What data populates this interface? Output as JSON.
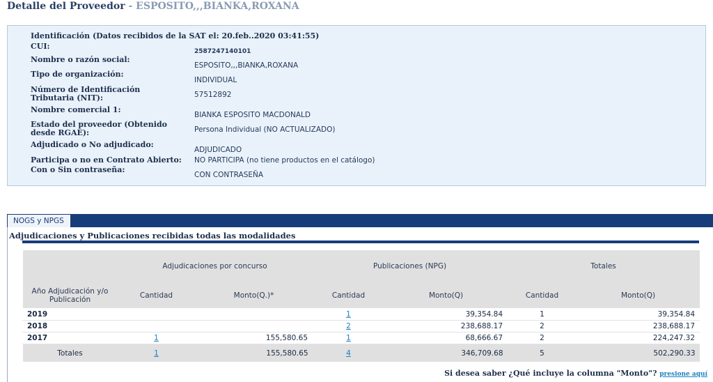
{
  "header": {
    "title": "Detalle del Proveedor",
    "separator": " - ",
    "provider_name": "ESPOSITO,,,BIANKA,ROXANA"
  },
  "info": {
    "identification": "Identificación (Datos recibidos de la SAT el: 20.feb..2020 03:41:55)",
    "fields": [
      {
        "label": "CUI:",
        "value": "2587247140101"
      },
      {
        "label": "Nombre o razón social:",
        "value": "ESPOSITO,,,BIANKA,ROXANA"
      },
      {
        "label": "Tipo de organización:",
        "value": "INDIVIDUAL"
      },
      {
        "label": "Número de Identificación Tributaria (NIT):",
        "value": "57512892"
      },
      {
        "label": "Nombre comercial 1:",
        "value": "BIANKA ESPOSITO MACDONALD"
      },
      {
        "label": "Estado del proveedor (Obtenido desde RGAE):",
        "value": "Persona Individual (NO ACTUALIZADO)"
      },
      {
        "label": "Adjudicado o No adjudicado:",
        "value": "ADJUDICADO"
      },
      {
        "label": "Participa o no en Contrato Abierto:",
        "value": "NO PARTICIPA (no tiene productos en el catálogo)"
      },
      {
        "label": "Con o Sin contraseña:",
        "value": "CON CONTRASEÑA"
      }
    ]
  },
  "tabs": [
    {
      "label": "NOGS y NPGS",
      "active": true
    }
  ],
  "section": {
    "title": "Adjudicaciones y Publicaciones recibidas todas las modalidades"
  },
  "table": {
    "group_headers": [
      "Adjudicaciones por concurso",
      "Publicaciones (NPG)",
      "Totales"
    ],
    "columns": [
      "Año Adjudicación y/o Publicación",
      "Cantidad",
      "Monto(Q.)*",
      "Cantidad",
      "Monto(Q)",
      "Cantidad",
      "Monto(Q)"
    ],
    "rows": [
      {
        "year": "2019",
        "adj_qty": "",
        "adj_amount": "",
        "pub_qty": "1",
        "pub_amount": "39,354.84",
        "tot_qty": "1",
        "tot_amount": "39,354.84"
      },
      {
        "year": "2018",
        "adj_qty": "",
        "adj_amount": "",
        "pub_qty": "2",
        "pub_amount": "238,688.17",
        "tot_qty": "2",
        "tot_amount": "238,688.17"
      },
      {
        "year": "2017",
        "adj_qty": "1",
        "adj_amount": "155,580.65",
        "pub_qty": "1",
        "pub_amount": "68,666.67",
        "tot_qty": "2",
        "tot_amount": "224,247.32"
      }
    ],
    "totals": {
      "label": "Totales",
      "adj_qty": "1",
      "adj_amount": "155,580.65",
      "pub_qty": "4",
      "pub_amount": "346,709.68",
      "tot_qty": "5",
      "tot_amount": "502,290.33"
    }
  },
  "footer": {
    "question": "Si desea saber ¿Qué incluye la columna \"Monto\"?",
    "link": "presione aquí"
  },
  "colors": {
    "primary": "#173c7a",
    "panel_bg": "#e9f2fa",
    "link": "#1a7fc0",
    "header_bg": "#e0e0e0"
  }
}
